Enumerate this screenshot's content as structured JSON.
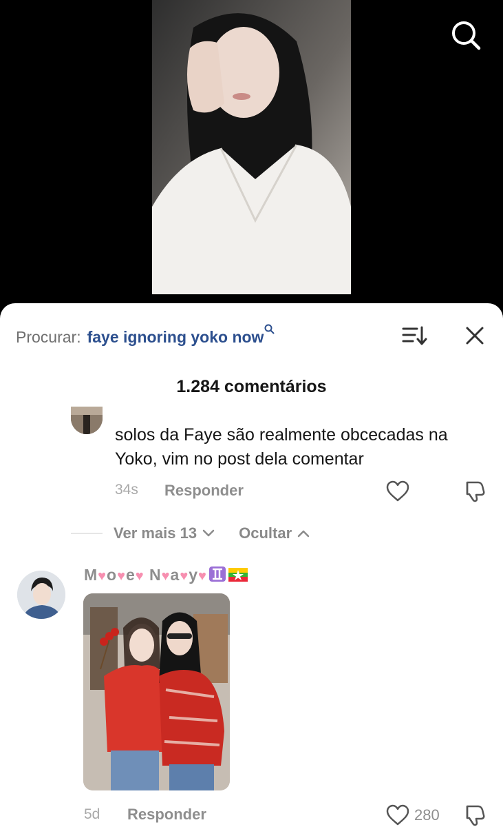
{
  "video": {
    "search_icon": "search-icon"
  },
  "panel": {
    "search_prefix": "Procurar:",
    "search_query": "faye ignoring yoko now",
    "comment_count": "1.284 comentários",
    "sort_icon": "sort-icon",
    "close_icon": "close-icon"
  },
  "reply": {
    "text": "solos da Faye são realmente obcecadas na Yoko, vim no post dela comentar",
    "time": "34s",
    "reply_label": "Responder"
  },
  "thread": {
    "more_label": "Ver mais 13",
    "hide_label": "Ocultar"
  },
  "comment": {
    "username_parts": [
      "M",
      "o",
      "e",
      " N",
      "a",
      "y"
    ],
    "time": "5d",
    "reply_label": "Responder",
    "likes": "280"
  },
  "colors": {
    "link_blue": "#2c4f8e",
    "muted_gray": "#8e8e8e",
    "pink_heart": "#f78fb0"
  }
}
